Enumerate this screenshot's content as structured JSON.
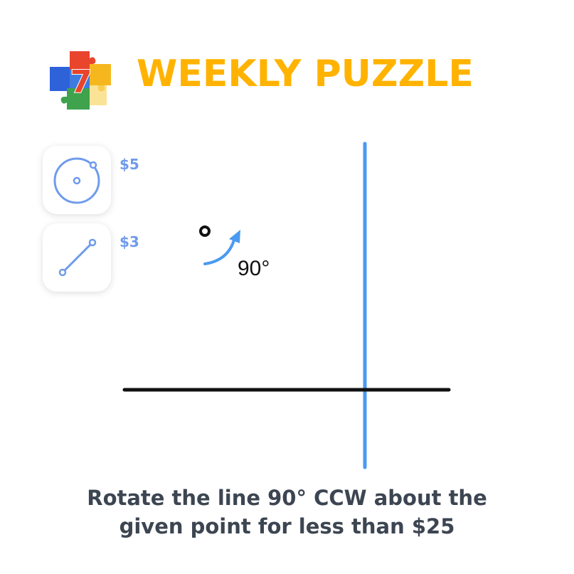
{
  "header": {
    "logo_numeral": "7",
    "title": "WEEKLY PUZZLE"
  },
  "tools": [
    {
      "icon": "circle-tool-icon",
      "price": "$5"
    },
    {
      "icon": "line-segment-tool-icon",
      "price": "$3"
    }
  ],
  "board": {
    "angle_label": "90°",
    "colors": {
      "given_line": "#111111",
      "vertical_line": "#4A9AF0",
      "rotation_arrow": "#4A9AF0",
      "point": "#111111"
    }
  },
  "instruction": {
    "line1": "Rotate the line 90° CCW about the",
    "line2": "given point for less than $25"
  },
  "theme": {
    "title_color": "#FFB300",
    "price_color": "#6F9BEB",
    "caption_color": "#3C4551"
  }
}
